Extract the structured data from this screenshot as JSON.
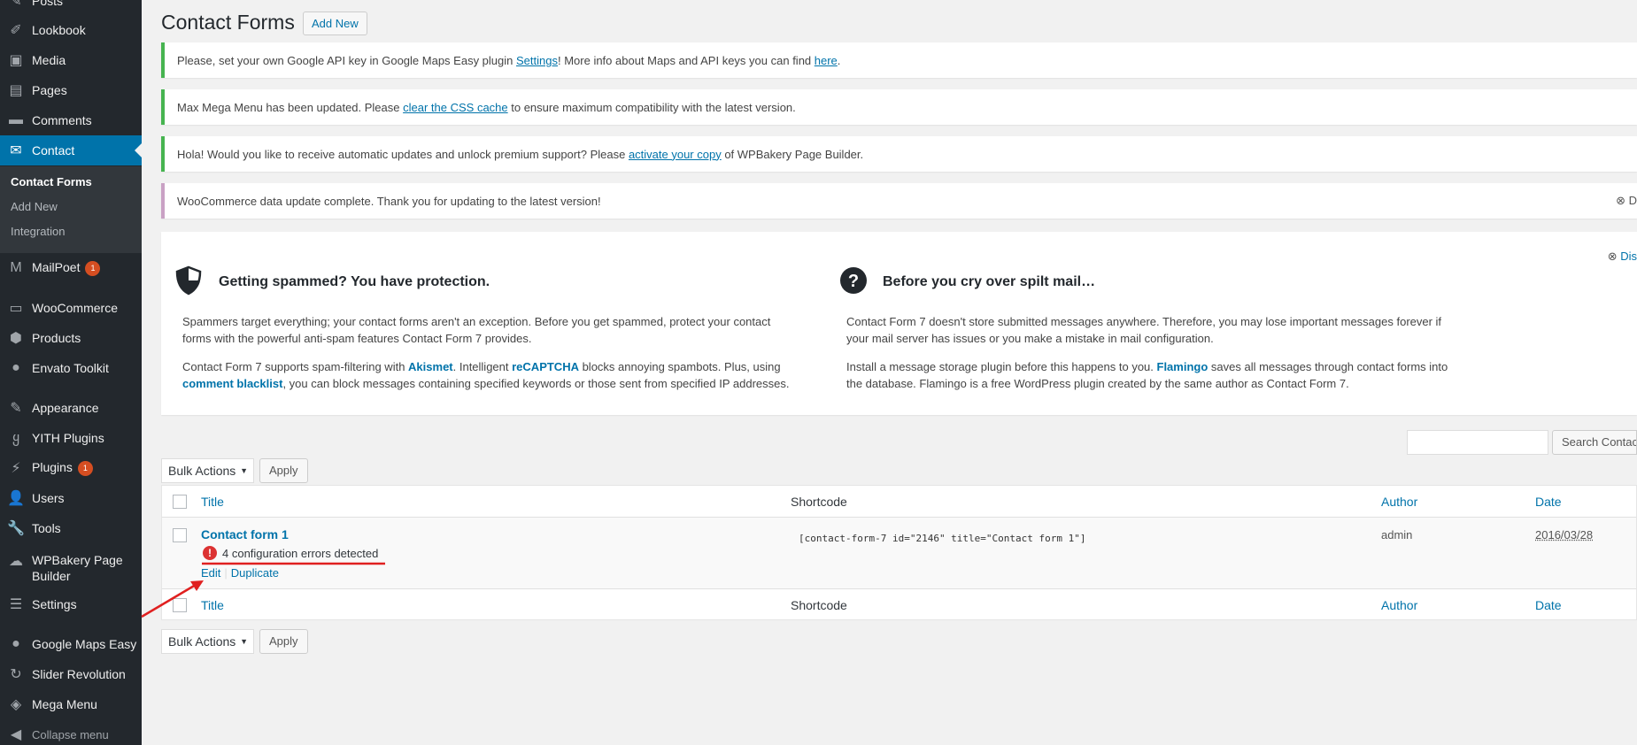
{
  "sidebar": {
    "items": [
      {
        "label": "Posts",
        "icon": "pin-icon"
      },
      {
        "label": "Lookbook",
        "icon": "brush-icon"
      },
      {
        "label": "Media",
        "icon": "media-icon"
      },
      {
        "label": "Pages",
        "icon": "page-icon"
      },
      {
        "label": "Comments",
        "icon": "comment-icon"
      },
      {
        "label": "Contact",
        "icon": "mail-icon"
      },
      {
        "label": "MailPoet",
        "icon": "mailpoet-icon",
        "badge": "1"
      },
      {
        "label": "WooCommerce",
        "icon": "woo-icon"
      },
      {
        "label": "Products",
        "icon": "box-icon"
      },
      {
        "label": "Envato Toolkit",
        "icon": "leaf-icon"
      },
      {
        "label": "Appearance",
        "icon": "brush-icon"
      },
      {
        "label": "YITH Plugins",
        "icon": "yith-icon"
      },
      {
        "label": "Plugins",
        "icon": "plug-icon",
        "badge": "1"
      },
      {
        "label": "Users",
        "icon": "user-icon"
      },
      {
        "label": "Tools",
        "icon": "wrench-icon"
      },
      {
        "label": "WPBakery Page Builder",
        "icon": "cloud-icon"
      },
      {
        "label": "Settings",
        "icon": "settings-icon"
      },
      {
        "label": "Google Maps Easy",
        "icon": "map-icon"
      },
      {
        "label": "Slider Revolution",
        "icon": "refresh-icon"
      },
      {
        "label": "Mega Menu",
        "icon": "menu-icon"
      },
      {
        "label": "Collapse menu",
        "icon": "collapse-icon"
      }
    ],
    "submenu": [
      "Contact Forms",
      "Add New",
      "Integration"
    ]
  },
  "page": {
    "title": "Contact Forms",
    "add_new": "Add New"
  },
  "notices": [
    {
      "pre": "Please, set your own Google API key in Google Maps Easy plugin ",
      "link1": "Settings",
      "mid": "! More info about Maps and API keys you can find ",
      "link2": "here",
      "post": "."
    },
    {
      "pre": "Max Mega Menu has been updated. Please ",
      "link1": "clear the CSS cache",
      "post": " to ensure maximum compatibility with the latest version."
    },
    {
      "pre": "Hola! Would you like to receive automatic updates and unlock premium support? Please ",
      "link1": "activate your copy",
      "post": " of WPBakery Page Builder."
    },
    {
      "text": "WooCommerce data update complete. Thank you for updating to the latest version!",
      "dismiss": "D"
    }
  ],
  "welcome": {
    "dismiss": "Dis",
    "col1": {
      "title": "Getting spammed? You have protection.",
      "p1": "Spammers target everything; your contact forms aren't an exception. Before you get spammed, protect your contact forms with the powerful anti-spam features Contact Form 7 provides.",
      "p2_pre": "Contact Form 7 supports spam-filtering with ",
      "p2_l1": "Akismet",
      "p2_mid": ". Intelligent ",
      "p2_l2": "reCAPTCHA",
      "p2_mid2": " blocks annoying spambots. Plus, using ",
      "p2_l3": "comment blacklist",
      "p2_post": ", you can block messages containing specified keywords or those sent from specified IP addresses."
    },
    "col2": {
      "title": "Before you cry over spilt mail…",
      "p1": "Contact Form 7 doesn't store submitted messages anywhere. Therefore, you may lose important messages forever if your mail server has issues or you make a mistake in mail configuration.",
      "p2_pre": "Install a message storage plugin before this happens to you. ",
      "p2_l1": "Flamingo",
      "p2_post": " saves all messages through contact forms into the database. Flamingo is a free WordPress plugin created by the same author as Contact Form 7."
    }
  },
  "search": {
    "button": "Search Contact"
  },
  "bulk": {
    "label": "Bulk Actions",
    "apply": "Apply"
  },
  "table": {
    "columns": [
      "Title",
      "Shortcode",
      "Author",
      "Date"
    ],
    "rows": [
      {
        "title": "Contact form 1",
        "error": "4 configuration errors detected",
        "actions": [
          "Edit",
          "Duplicate"
        ],
        "shortcode": "[contact-form-7 id=\"2146\" title=\"Contact form 1\"]",
        "author": "admin",
        "date": "2016/03/28"
      }
    ]
  }
}
